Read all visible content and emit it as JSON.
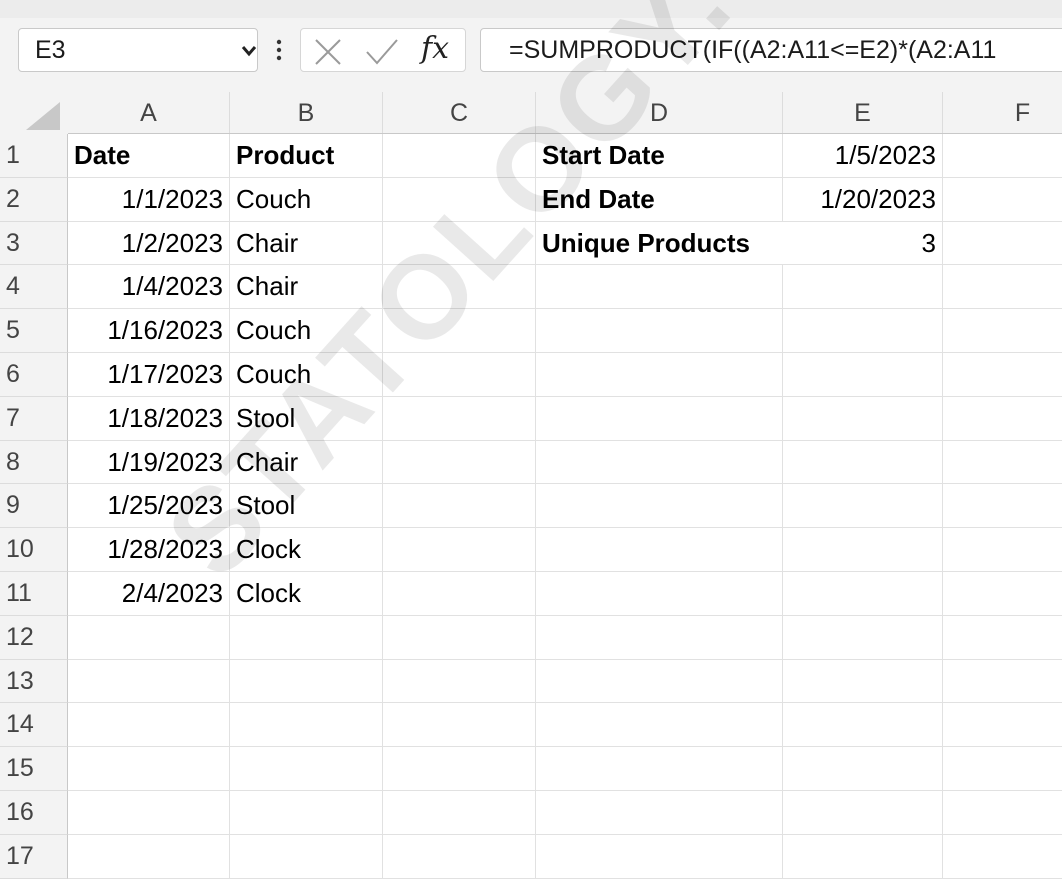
{
  "formula_bar": {
    "name_box": "E3",
    "fx_label": "fx",
    "formula": "=SUMPRODUCT(IF((A2:A11<=E2)*(A2:A11"
  },
  "columns": [
    "A",
    "B",
    "C",
    "D",
    "E",
    "F"
  ],
  "rows": [
    "1",
    "2",
    "3",
    "4",
    "5",
    "6",
    "7",
    "8",
    "9",
    "10",
    "11",
    "12",
    "13",
    "14",
    "15",
    "16",
    "17"
  ],
  "table": {
    "header_date": "Date",
    "header_product": "Product",
    "records": [
      {
        "date": "1/1/2023",
        "product": "Couch"
      },
      {
        "date": "1/2/2023",
        "product": "Chair"
      },
      {
        "date": "1/4/2023",
        "product": "Chair"
      },
      {
        "date": "1/16/2023",
        "product": "Couch"
      },
      {
        "date": "1/17/2023",
        "product": "Couch"
      },
      {
        "date": "1/18/2023",
        "product": "Stool"
      },
      {
        "date": "1/19/2023",
        "product": "Chair"
      },
      {
        "date": "1/25/2023",
        "product": "Stool"
      },
      {
        "date": "1/28/2023",
        "product": "Clock"
      },
      {
        "date": "2/4/2023",
        "product": "Clock"
      }
    ]
  },
  "summary": {
    "start_label": "Start Date",
    "start_value": "1/5/2023",
    "end_label": "End Date",
    "end_value": "1/20/2023",
    "unique_label": "Unique Products",
    "unique_value": "3"
  },
  "watermark": "STATOLOGY.COM"
}
